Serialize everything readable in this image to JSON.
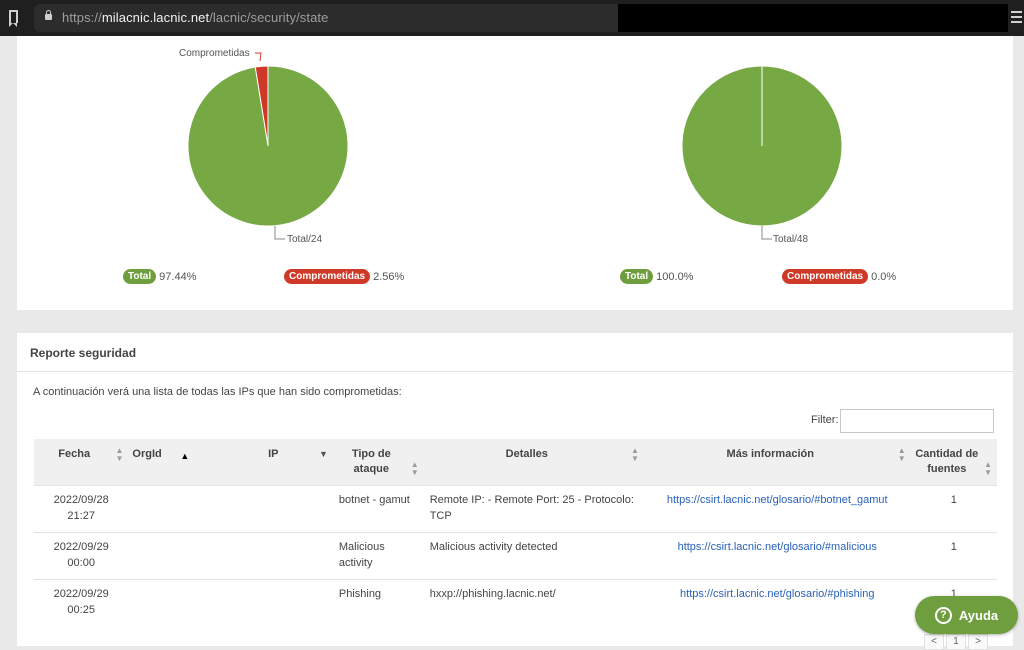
{
  "browser": {
    "url_scheme": "https://",
    "url_host": "milacnic.lacnic.net",
    "url_path": "/lacnic/security/state"
  },
  "charts": {
    "left": {
      "slice_label": "Comprometidas",
      "total_label": "Total/24",
      "legend_total_badge": "Total",
      "legend_total_value": "97.44%",
      "legend_comp_badge": "Comprometidas",
      "legend_comp_value": "2.56%"
    },
    "right": {
      "total_label": "Total/48",
      "legend_total_badge": "Total",
      "legend_total_value": "100.0%",
      "legend_comp_badge": "Comprometidas",
      "legend_comp_value": "0.0%"
    }
  },
  "chart_data": [
    {
      "type": "pie",
      "categories": [
        "Total",
        "Comprometidas"
      ],
      "values": [
        97.44,
        2.56
      ],
      "colors": [
        "#76a844",
        "#cf3a28"
      ]
    },
    {
      "type": "pie",
      "categories": [
        "Total",
        "Comprometidas"
      ],
      "values": [
        100.0,
        0.0
      ],
      "colors": [
        "#76a844",
        "#cf3a28"
      ]
    }
  ],
  "report": {
    "title": "Reporte seguridad",
    "intro": "A continuación verá una lista de todas las IPs que han sido comprometidas:",
    "filter_label": "Filter:",
    "filter_value": "",
    "headers": {
      "fecha": "Fecha",
      "orgid": "OrgId",
      "ip": "IP",
      "tipo": "Tipo de ataque",
      "detalles": "Detalles",
      "mas": "Más información",
      "cantidad": "Cantidad de fuentes"
    },
    "rows": [
      {
        "fecha": "2022/09/28 21:27",
        "orgid": "",
        "ip": "",
        "tipo": "botnet - gamut",
        "detalles": "Remote IP: - Remote Port: 25 - Protocolo: TCP",
        "mas": "https://csirt.lacnic.net/glosario/#botnet_gamut",
        "cantidad": "1"
      },
      {
        "fecha": "2022/09/29 00:00",
        "orgid": "",
        "ip": "",
        "tipo": "Malicious activity",
        "detalles": "Malicious activity detected",
        "mas": "https://csirt.lacnic.net/glosario/#malicious",
        "cantidad": "1"
      },
      {
        "fecha": "2022/09/29 00:25",
        "orgid": "",
        "ip": "",
        "tipo": "Phishing",
        "detalles": "hxxp://phishing.lacnic.net/",
        "mas": "https://csirt.lacnic.net/glosario/#phishing",
        "cantidad": "1"
      }
    ],
    "pager": {
      "prev": "<",
      "page": "1",
      "next": ">"
    }
  },
  "help": {
    "label": "Ayuda",
    "icon": "question-circle-icon"
  }
}
